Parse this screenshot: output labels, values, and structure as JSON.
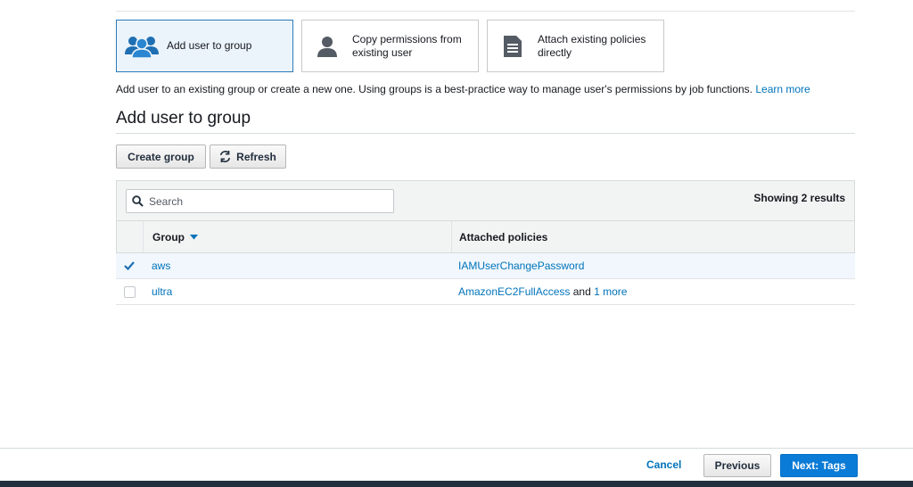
{
  "options": {
    "add_to_group": "Add user to group",
    "copy_permissions": "Copy permissions from existing user",
    "attach_policies": "Attach existing policies directly"
  },
  "description": {
    "text": "Add user to an existing group or create a new one. Using groups is a best-practice way to manage user's permissions by job functions.",
    "learn_more": "Learn more"
  },
  "section_title": "Add user to group",
  "toolbar": {
    "create_group": "Create group",
    "refresh": "Refresh"
  },
  "table": {
    "search_placeholder": "Search",
    "showing": "Showing 2 results",
    "columns": {
      "group": "Group",
      "policies": "Attached policies"
    },
    "rows": [
      {
        "group": "aws",
        "policy": "IAMUserChangePassword",
        "policy_suffix": "",
        "more": "",
        "checked": true
      },
      {
        "group": "ultra",
        "policy": "AmazonEC2FullAccess",
        "policy_suffix": " and ",
        "more": "1 more",
        "checked": false
      }
    ]
  },
  "footer": {
    "cancel": "Cancel",
    "previous": "Previous",
    "next": "Next: Tags"
  },
  "colors": {
    "link": "#0073bb",
    "primary": "#0a7bd6",
    "selected_bg": "#ebf4fb",
    "bottom_bar": "#232f3e"
  },
  "icons": {
    "add_to_group": "users-group-icon",
    "copy_permissions": "user-icon",
    "attach_policies": "document-icon",
    "refresh": "refresh-icon",
    "search": "search-icon",
    "sort": "caret-down-icon"
  }
}
